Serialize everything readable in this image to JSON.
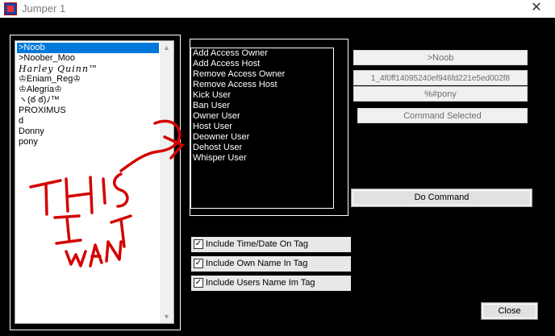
{
  "window": {
    "title": "Jumper 1",
    "close_glyph": "✕",
    "app_icon": "app-icon"
  },
  "user_list": {
    "items": [
      {
        "label": ">Noob",
        "selected": true
      },
      {
        "label": ">Noober_Moo",
        "selected": false
      },
      {
        "label": "Harley Quinn™",
        "selected": false,
        "script": true
      },
      {
        "label": "♔Eniam_Reg♔",
        "selected": false
      },
      {
        "label": "♔Alegria♔",
        "selected": false
      },
      {
        "label": "ヽ(ఠ ఠ)ﾉ™",
        "selected": false
      },
      {
        "label": "PROXIMUS",
        "selected": false
      },
      {
        "label": "d",
        "selected": false
      },
      {
        "label": "Donny",
        "selected": false
      },
      {
        "label": "pony",
        "selected": false
      }
    ],
    "scroll_up": "▲",
    "scroll_down": "▼"
  },
  "commands": {
    "items": [
      "Add Access Owner",
      "Add Access Host",
      "Remove Access Owner",
      "Remove Access Host",
      "Kick User",
      "Ban User",
      "Owner User",
      "Host User",
      "Deowner User",
      "Dehost User",
      "Whisper User"
    ]
  },
  "details": {
    "name": ">Noob",
    "id": "1_4f0ff14095240ef946fd221e5ed002f8",
    "tag": "%#pony",
    "command_selected": "Command Selected"
  },
  "do_command_label": "Do Command",
  "options": [
    {
      "label": "Include Time/Date On Tag",
      "checked": true
    },
    {
      "label": "Include Own Name In Tag",
      "checked": true
    },
    {
      "label": "Include Users Name Im Tag",
      "checked": true
    }
  ],
  "check_glyph": "✓",
  "close_label": "Close",
  "annotation": {
    "text": "TH IS I WANT",
    "color": "#d40000"
  }
}
